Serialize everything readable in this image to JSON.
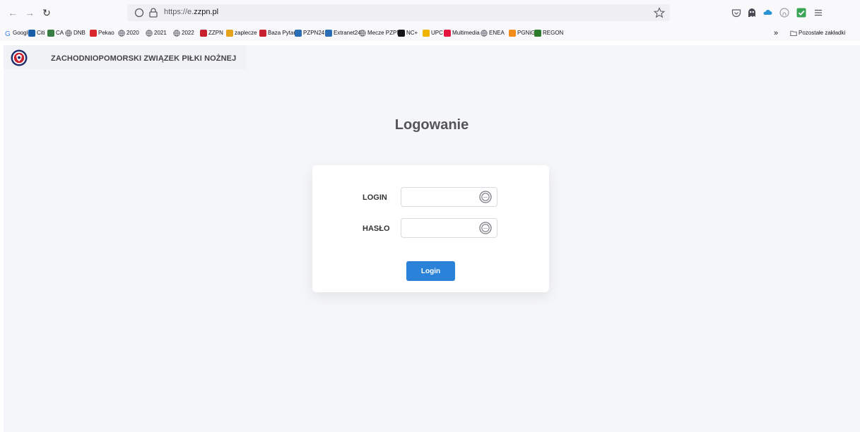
{
  "browser": {
    "url_prefix": "https://e.",
    "url_domain": "zzpn.pl",
    "bookmarks": [
      {
        "label": "Google",
        "icon": "google-g",
        "color": "#4285f4"
      },
      {
        "label": "Citi",
        "icon": "citi-logo",
        "color": "#1a5ea8"
      },
      {
        "label": "CA",
        "icon": "ca-logo",
        "color": "#3a7d44"
      },
      {
        "label": "DNB",
        "icon": "globe-icon",
        "color": "#5b5b66"
      },
      {
        "label": "Pekao",
        "icon": "pekao-logo",
        "color": "#d9262c"
      },
      {
        "label": "2020",
        "icon": "globe-icon",
        "color": "#5b5b66"
      },
      {
        "label": "2021",
        "icon": "globe-icon",
        "color": "#5b5b66"
      },
      {
        "label": "2022",
        "icon": "globe-icon",
        "color": "#5b5b66"
      },
      {
        "label": "ZZPN",
        "icon": "zzpn-logo",
        "color": "#c8202f"
      },
      {
        "label": "zaplecze",
        "icon": "zaplecze-logo",
        "color": "#e6a21a"
      },
      {
        "label": "Baza Pytań",
        "icon": "zzpn-logo",
        "color": "#c8202f"
      },
      {
        "label": "PZPN24",
        "icon": "pzpn-logo",
        "color": "#2a6fb5"
      },
      {
        "label": "Extranet24",
        "icon": "pzpn-logo",
        "color": "#2a6fb5"
      },
      {
        "label": "Mecze PZPN",
        "icon": "globe-icon",
        "color": "#5b5b66"
      },
      {
        "label": "NC+",
        "icon": "ncplus-logo",
        "color": "#15141a"
      },
      {
        "label": "UPC",
        "icon": "upc-logo",
        "color": "#f0b400"
      },
      {
        "label": "Multimedia",
        "icon": "multimedia-logo",
        "color": "#e5163d"
      },
      {
        "label": "ENEA",
        "icon": "globe-icon",
        "color": "#5b5b66"
      },
      {
        "label": "PGNiG",
        "icon": "pgnig-logo",
        "color": "#f28c1a"
      },
      {
        "label": "REGON",
        "icon": "regon-logo",
        "color": "#2d7a2d"
      }
    ],
    "overflow_label": "»",
    "other_bookmarks": "Pozostałe zakładki"
  },
  "site": {
    "title": "ZACHODNIOPOMORSKI ZWIĄZEK PIŁKI NOŻNEJ"
  },
  "login": {
    "heading": "Logowanie",
    "login_label": "LOGIN",
    "login_value": "",
    "password_label": "HASŁO",
    "password_value": "",
    "submit_label": "Login"
  },
  "colors": {
    "accent": "#2b83d9",
    "page_bg": "#f5f6fa"
  }
}
